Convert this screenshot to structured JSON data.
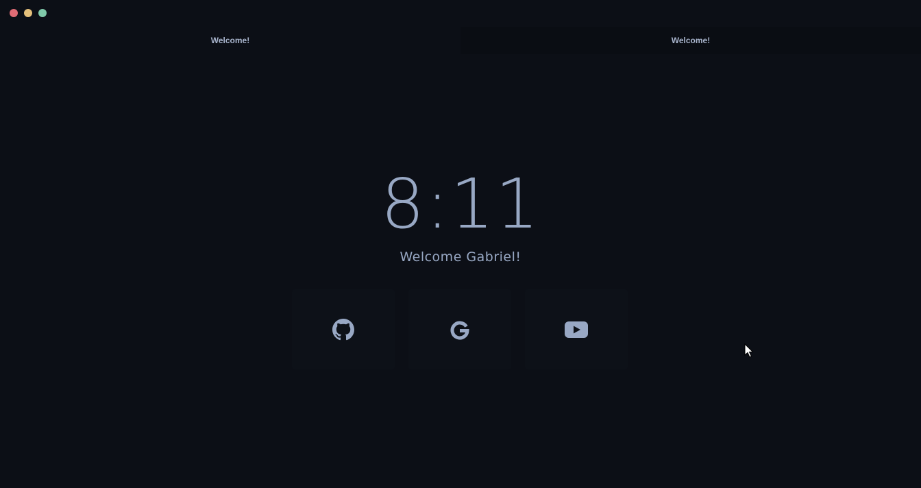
{
  "window": {
    "controls": [
      {
        "name": "close",
        "color": "#e06c75"
      },
      {
        "name": "minimize",
        "color": "#e5c07b"
      },
      {
        "name": "maximize",
        "color": "#7fc8a9"
      }
    ]
  },
  "tabs": [
    {
      "label": "Welcome!",
      "active": true
    },
    {
      "label": "Welcome!",
      "active": false
    }
  ],
  "clock": {
    "time": "8:11"
  },
  "greeting": {
    "text": "Welcome Gabriel!"
  },
  "links": [
    {
      "name": "github",
      "icon": "github-icon"
    },
    {
      "name": "google",
      "icon": "google-icon"
    },
    {
      "name": "youtube",
      "icon": "youtube-icon"
    }
  ],
  "colors": {
    "background": "#0c0f16",
    "card": "#0d1118",
    "text": "#98a8c4"
  }
}
